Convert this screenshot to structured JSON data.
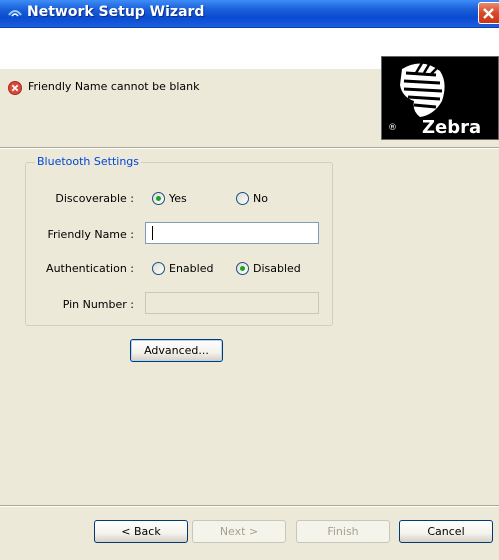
{
  "window": {
    "title": "Network Setup Wizard",
    "icon": "network-icon",
    "close_icon": "close-icon"
  },
  "header": {
    "error_icon": "error-x-icon",
    "error_message": "Friendly Name cannot be blank",
    "logo_text": "Zebra",
    "logo_mark": "®",
    "logo_icon": "zebra-head-icon"
  },
  "bluetooth": {
    "group_title": "Bluetooth Settings",
    "discoverable_label": "Discoverable :",
    "discoverable_options": [
      "Yes",
      "No"
    ],
    "discoverable_selected": "Yes",
    "friendly_name_label": "Friendly Name :",
    "friendly_name_value": "",
    "authentication_label": "Authentication :",
    "authentication_options": [
      "Enabled",
      "Disabled"
    ],
    "authentication_selected": "Disabled",
    "pin_label": "Pin Number :",
    "pin_value": "",
    "advanced_button": "Advanced..."
  },
  "footer": {
    "back_button": "< Back",
    "next_button": "Next >",
    "finish_button": "Finish",
    "cancel_button": "Cancel"
  },
  "colors": {
    "titlebar": "#0a4bd0",
    "group_title": "#0046d5",
    "error_icon": "#d84a3a",
    "window_bg": "#ece9d8"
  }
}
